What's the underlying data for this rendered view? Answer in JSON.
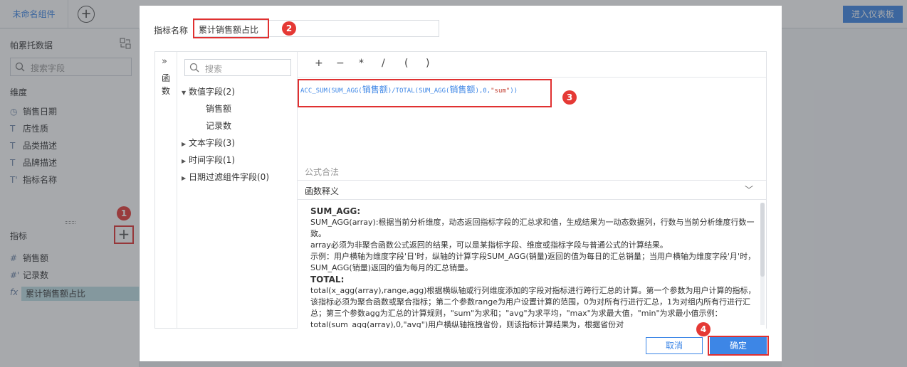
{
  "app": {
    "tab_name": "未命名组件",
    "enter_dashboard": "进入仪表板"
  },
  "left_panel": {
    "title": "帕累托数据",
    "search_placeholder": "搜索字段",
    "dimension_label": "维度",
    "dimensions": [
      {
        "icon": "clock-icon",
        "label": "销售日期"
      },
      {
        "icon": "text-icon",
        "label": "店性质"
      },
      {
        "icon": "text-icon",
        "label": "品类描述"
      },
      {
        "icon": "text-icon",
        "label": "品牌描述"
      },
      {
        "icon": "text-icon",
        "label": "指标名称"
      }
    ],
    "metric_label": "指标",
    "metrics": [
      {
        "icon": "hash-icon",
        "label": "销售额"
      },
      {
        "icon": "hash-icon",
        "label": "记录数"
      },
      {
        "icon": "fx-icon",
        "label": "累计销售额占比"
      }
    ]
  },
  "dialog": {
    "name_label": "指标名称",
    "name_value": "累计销售额占比",
    "function_label": "函数",
    "field_search_placeholder": "搜索",
    "tree": {
      "numeric": "数值字段(2)",
      "numeric_children": [
        "销售额",
        "记录数"
      ],
      "text": "文本字段(3)",
      "time": "时间字段(1)",
      "date_filter": "日期过滤组件字段(0)"
    },
    "operators": [
      "+",
      "−",
      "*",
      "/",
      "(",
      ")"
    ],
    "formula": {
      "part1": "ACC_SUM(SUM_AGG(",
      "field1": "销售额",
      "part2": ")/TOTAL(SUM_AGG(",
      "field2": "销售额",
      "part3": "),0,",
      "str": "\"sum\"",
      "part4": "))"
    },
    "syntax_status": "公式合法",
    "explain_title": "函数释义",
    "explain": {
      "h1": "SUM_AGG:",
      "p1": "SUM_AGG(array):根据当前分析维度，动态返回指标字段的汇总求和值，生成结果为一动态数据列，行数与当前分析维度行数一致。",
      "p2": " array必须为非聚合函数公式返回的结果，可以是某指标字段、维度或指标字段与普通公式的计算结果。",
      "p3": " 示例：用户横轴为维度字段'日'时，纵轴的计算字段SUM_AGG(销量)返回的值为每日的汇总销量；当用户横轴为维度字段'月'时，SUM_AGG(销量)返回的值为每月的汇总销量。",
      "h2": "TOTAL:",
      "p4": "total(x_agg(array),range,agg)根据横纵轴或行列维度添加的字段对指标进行跨行汇总的计算。第一个参数为用户计算的指标，该指标必须为聚合函数或聚合指标；第二个参数range为用户设置计算的范围，0为对所有行进行汇总，1为对组内所有行进行汇总；第三个参数agg为汇总的计算规则，\"sum\"为求和；\"avg\"为求平均，\"max\"为求最大值，\"min\"为求最小值示例：total(sum_agg(array),0,\"avg\")用户横纵轴拖拽省份，则该指标计算结果为，根据省份对"
    },
    "cancel": "取消",
    "ok": "确定"
  },
  "badges": [
    "1",
    "2",
    "3",
    "4"
  ]
}
